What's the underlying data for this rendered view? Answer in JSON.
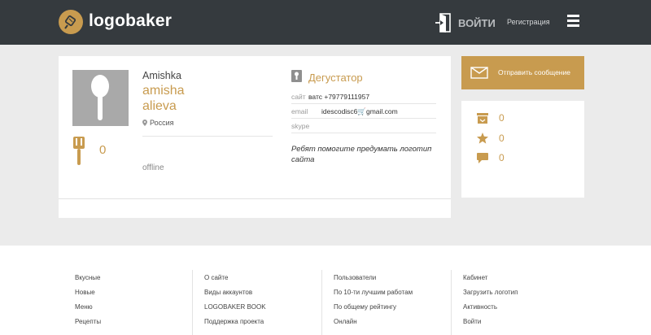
{
  "header": {
    "logo_text": "logobaker",
    "login_label": "ВОЙТИ",
    "register_label": "Регистрация"
  },
  "profile": {
    "username": "Amishka",
    "first_name": "amisha",
    "last_name": "alieva",
    "location": "Россия",
    "works_count": "0",
    "status": "offline",
    "role": "Дегустатор",
    "site_label": "сайт",
    "site_value": "ватс +79779111957",
    "email_label": "email",
    "email_value": "idescodisc6🛒gmail.com",
    "skype_label": "skype",
    "skype_value": "",
    "about": "Ребят помогите предумать логотип сайта"
  },
  "actions": {
    "send_message_label": "Отправить сообщение"
  },
  "stats": {
    "items": [
      {
        "icon": "inbox-icon",
        "value": "0"
      },
      {
        "icon": "star-icon",
        "value": "0"
      },
      {
        "icon": "comment-icon",
        "value": "0"
      }
    ]
  },
  "footer": {
    "columns": [
      [
        "Вкусные",
        "Новые",
        "Меню",
        "Рецепты"
      ],
      [
        "О сайте",
        "Виды аккаунтов",
        "LOGOBAKER BOOK",
        "Поддержка проекта"
      ],
      [
        "Пользователи",
        "По 10-ти лучшим работам",
        "По общему рейтингу",
        "Онлайн"
      ],
      [
        "Кабинет",
        "Загрузить логотип",
        "Активность",
        "Войти"
      ]
    ]
  },
  "colors": {
    "accent": "#c89b4f",
    "header_bg": "#353a3e",
    "page_bg": "#ebebeb"
  }
}
